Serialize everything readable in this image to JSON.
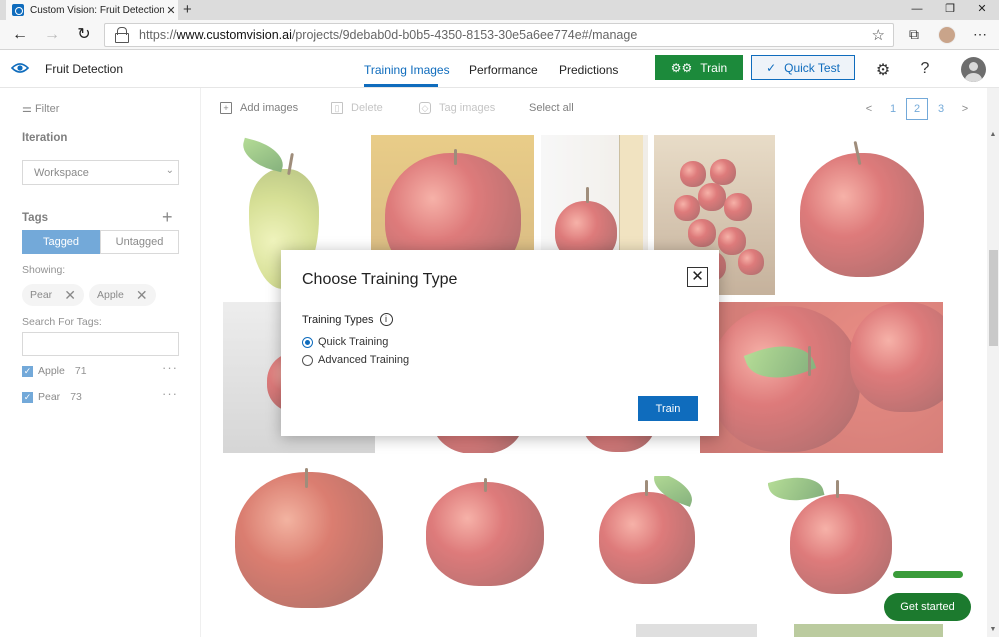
{
  "browser": {
    "tab_title": "Custom Vision: Fruit Detection -",
    "tab_close": "✕",
    "newtab": "+",
    "window_controls": [
      "—",
      "❐",
      "✕"
    ],
    "url_scheme": "https://",
    "url_host": "www.customvision.ai",
    "url_path": "/projects/9debab0d-b0b5-4350-8153-30e5a6ee774e#/manage"
  },
  "header": {
    "app_name": "Fruit Detection",
    "tabs": [
      "Training Images",
      "Performance",
      "Predictions"
    ],
    "train_label": "Train",
    "quick_test_label": "Quick Test",
    "help": "?"
  },
  "sidebar": {
    "filter_label": "Filter",
    "iteration_heading": "Iteration",
    "iteration_value": "Workspace",
    "tags_heading": "Tags",
    "tagged_label": "Tagged",
    "untagged_label": "Untagged",
    "showing_label": "Showing:",
    "chips": [
      "Pear",
      "Apple"
    ],
    "search_label": "Search For Tags:",
    "tags": [
      {
        "name": "Apple",
        "count": "71"
      },
      {
        "name": "Pear",
        "count": "73"
      }
    ]
  },
  "toolbar": {
    "add_images": "Add images",
    "delete": "Delete",
    "tag_images": "Tag images",
    "select_all": "Select all"
  },
  "pagination": {
    "prev": "<",
    "pages": [
      "1",
      "2",
      "3"
    ],
    "current": "2",
    "next": ">"
  },
  "dialog": {
    "title": "Choose Training Type",
    "close_glyph": "✕",
    "training_types_label": "Training Types",
    "options": [
      "Quick Training",
      "Advanced Training"
    ],
    "selected": "Quick Training",
    "train_button": "Train"
  },
  "get_started": "Get started",
  "colors": {
    "accent": "#0f6cbd",
    "train_green": "#1c8a3b",
    "get_started_green": "#1c7a2e"
  }
}
